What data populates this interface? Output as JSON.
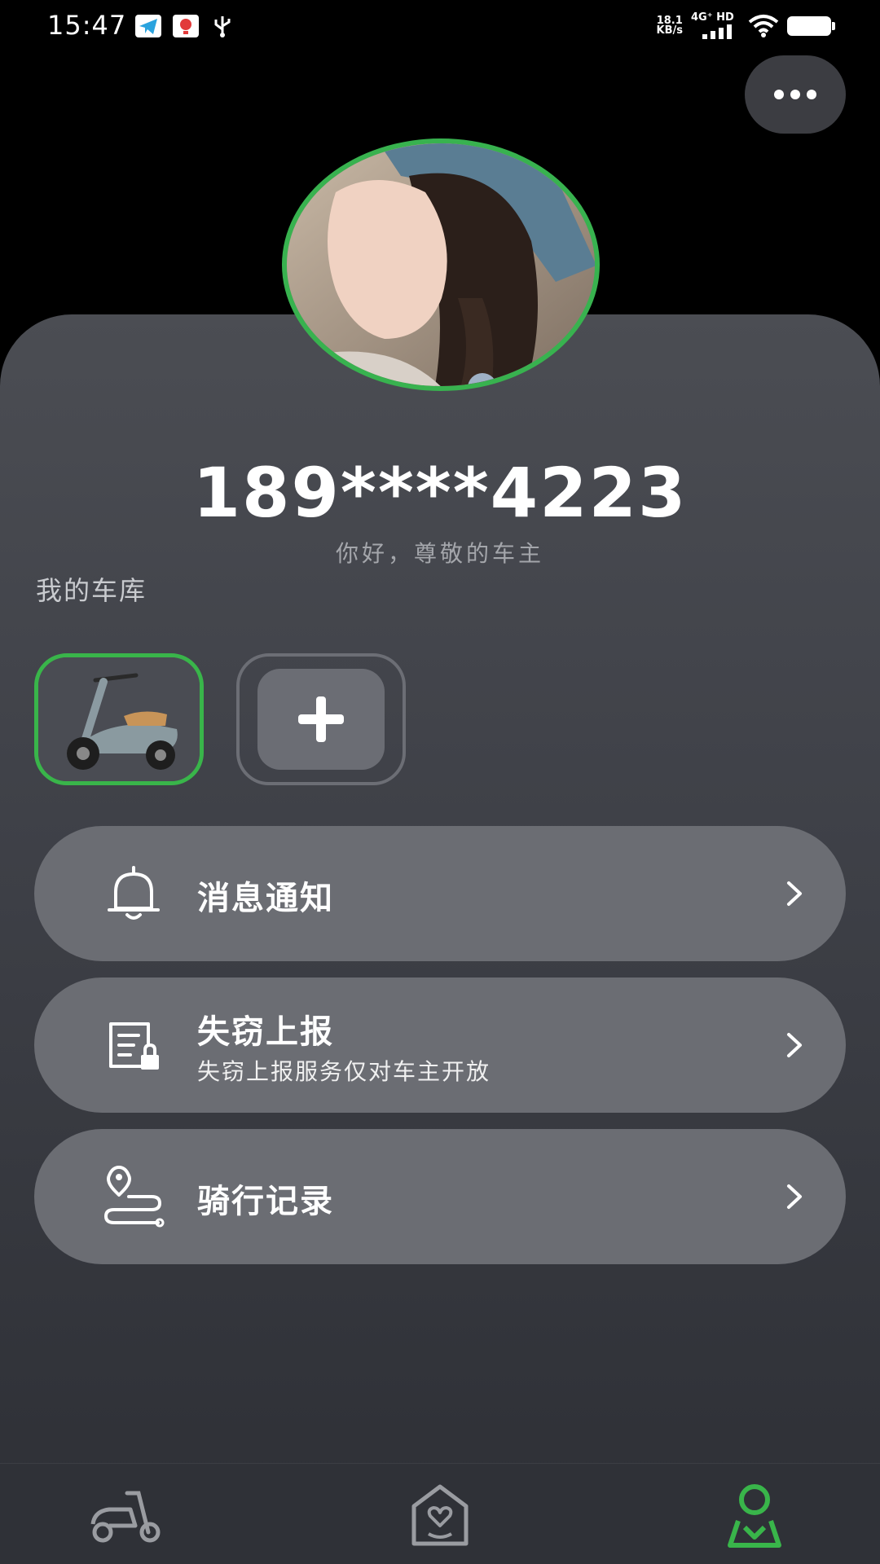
{
  "status_bar": {
    "time": "15:47",
    "net_speed_value": "18.1",
    "net_speed_unit": "KB/s",
    "signal_label": "4G⁺ HD",
    "icons": [
      "telegram-icon",
      "notification-app-icon",
      "usb-icon",
      "signal-icon",
      "wifi-icon",
      "battery-icon"
    ]
  },
  "header": {
    "more_icon": "more-dots-icon"
  },
  "profile": {
    "phone": "189****4223",
    "greeting": "你好，尊敬的车主"
  },
  "garage": {
    "label": "我的车库",
    "vehicles": [
      {
        "icon": "scooter-image",
        "selected": true
      }
    ],
    "add_icon": "plus-icon"
  },
  "menu": [
    {
      "title": "消息通知",
      "subtitle": "",
      "icon": "bell-icon"
    },
    {
      "title": "失窃上报",
      "subtitle": "失窃上报服务仅对车主开放",
      "icon": "report-lock-icon"
    },
    {
      "title": "骑行记录",
      "subtitle": "",
      "icon": "route-pin-icon"
    }
  ],
  "bottom_nav": [
    {
      "icon": "scooter-tab-icon",
      "active": false
    },
    {
      "icon": "home-heart-icon",
      "active": false
    },
    {
      "icon": "profile-map-icon",
      "active": true
    }
  ],
  "colors": {
    "accent": "#38b24f",
    "panel": "#43454c",
    "menu_item": "#6b6d73",
    "muted_text": "#a4a6ab"
  }
}
